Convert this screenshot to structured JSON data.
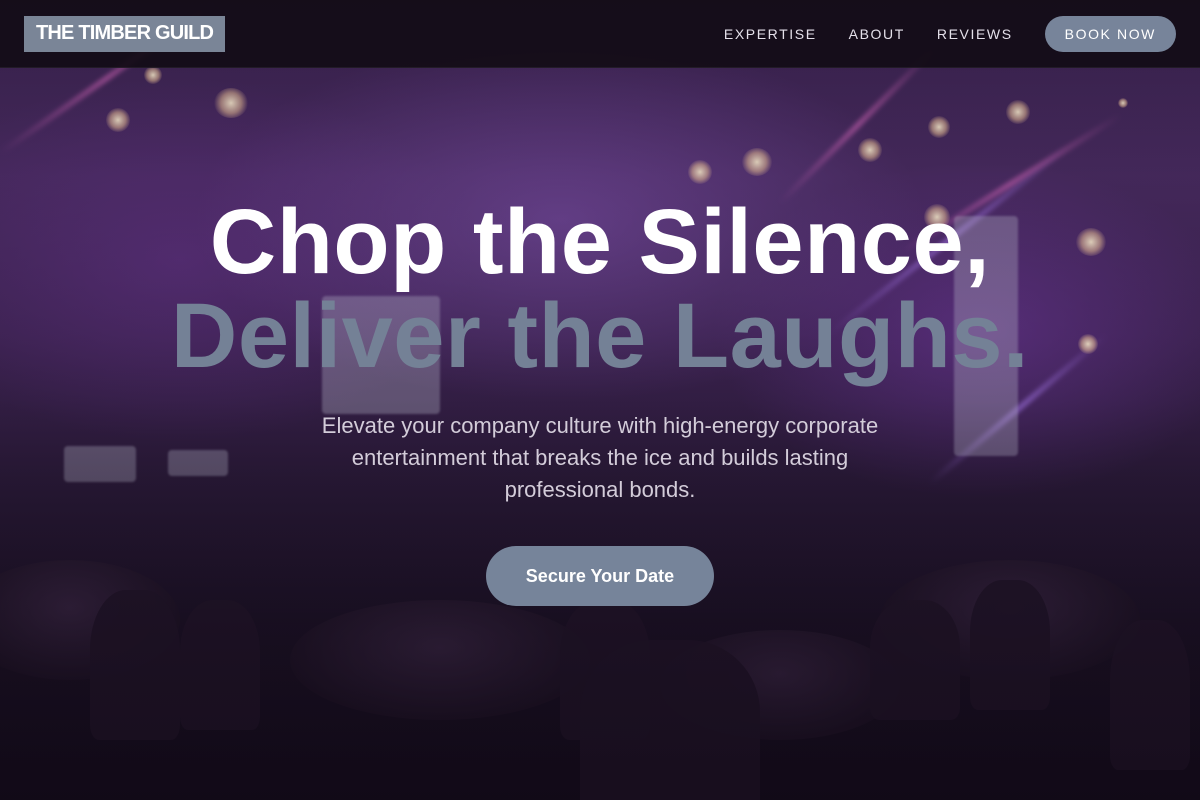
{
  "header": {
    "logo": "THE TIMBER GUILD",
    "nav": [
      {
        "label": "EXPERTISE"
      },
      {
        "label": "ABOUT"
      },
      {
        "label": "REVIEWS"
      }
    ],
    "cta_label": "BOOK NOW"
  },
  "hero": {
    "headline_line1": "Chop the Silence,",
    "headline_line2": "Deliver the Laughs.",
    "subtext": "Elevate your company culture with high-energy corporate entertainment that breaks the ice and builds lasting professional bonds.",
    "cta_label": "Secure Your Date"
  },
  "colors": {
    "header_bg": "#120c16",
    "accent_slate": "#77849a",
    "headline_primary": "#ffffff",
    "headline_secondary": "#748196",
    "hero_tint": "#3b2350"
  }
}
